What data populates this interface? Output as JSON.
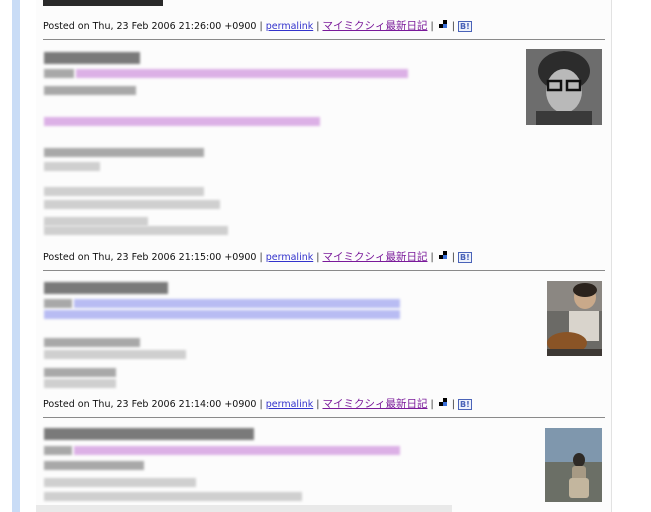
{
  "posts": [
    {
      "meta_prefix": "Posted on ",
      "timestamp": "Thu, 23 Feb 2006 21:26:00 +0900",
      "permalink_label": "permalink",
      "mixi_label": "マイミクシィ最新日記",
      "separator": " | "
    },
    {
      "meta_prefix": "Posted on ",
      "timestamp": "Thu, 23 Feb 2006 21:15:00 +0900",
      "permalink_label": "permalink",
      "mixi_label": "マイミクシィ最新日記",
      "separator": " | "
    },
    {
      "meta_prefix": "Posted on ",
      "timestamp": "Thu, 23 Feb 2006 21:14:00 +0900",
      "permalink_label": "permalink",
      "mixi_label": "マイミクシィ最新日記",
      "separator": " | "
    }
  ],
  "hatena_bookmark_label": "B!",
  "icons": [
    "hatena-antenna-icon",
    "hatena-bookmark-icon"
  ],
  "colors": {
    "link": "#3333cc",
    "mixi_link": "#7a1a9a",
    "rail": "#c9dcf6",
    "rule": "#8a8a8a"
  }
}
